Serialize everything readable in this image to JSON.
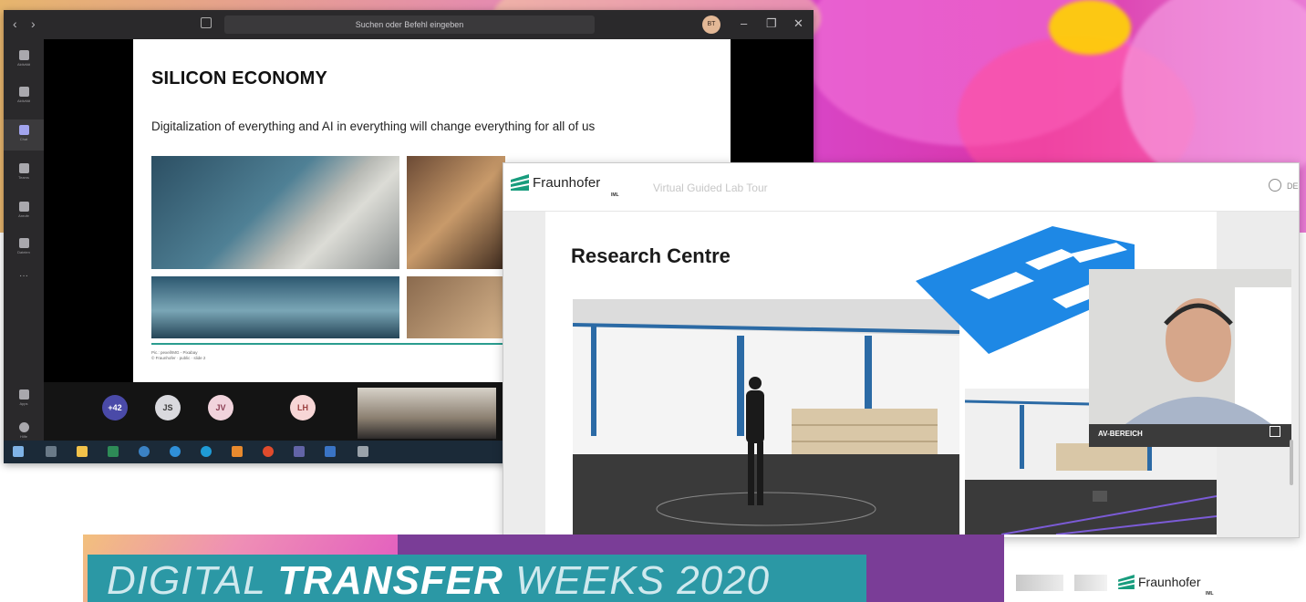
{
  "teams": {
    "search_placeholder": "Suchen oder Befehl eingeben",
    "nav_back": "‹",
    "nav_forward": "›",
    "avatar_initials": "BT",
    "controls": {
      "minimize": "–",
      "restore": "❐",
      "close": "✕"
    },
    "rail": [
      {
        "label": "Aktivität",
        "icon": "activity-icon"
      },
      {
        "label": "Aktivität",
        "icon": "bell-icon"
      },
      {
        "label": "Chat",
        "icon": "chat-icon",
        "active": true
      },
      {
        "label": "Teams",
        "icon": "teams-icon"
      },
      {
        "label": "Anrufe",
        "icon": "phone-icon"
      },
      {
        "label": "Dateien",
        "icon": "file-icon"
      },
      {
        "label": "···",
        "icon": "more-icon"
      },
      {
        "label": "Apps",
        "icon": "apps-icon"
      },
      {
        "label": "Hilfe",
        "icon": "help-icon"
      }
    ],
    "slide": {
      "title": "SILICON ECONOMY",
      "subtitle": "Digitalization of everything and AI in everything will change everything for all of us",
      "footer_line1": "Pic.: pexel/IMG - Pixabay",
      "footer_line2": "© Fraunhofer · public · slide 2"
    },
    "participants": [
      {
        "initials": "+42",
        "bg": "#4a4aa8",
        "fg": "#ffffff"
      },
      {
        "initials": "JS",
        "bg": "#d9d9de",
        "fg": "#3a3a3a"
      },
      {
        "initials": "JV",
        "bg": "#f1d3dc",
        "fg": "#8a3d52"
      },
      {
        "initials": "LH",
        "bg": "#f7d6d6",
        "fg": "#9b4040"
      }
    ]
  },
  "fraunhofer": {
    "logo_text": "Fraunhofer",
    "logo_sub": "IML",
    "tour_title": "Virtual Guided Lab Tour",
    "lang": "DE",
    "page_title": "Research Centre",
    "camera_label": "AV-BEREICH",
    "footer_logo": "Fraunhofer",
    "footer_sub": "IML"
  },
  "banner": {
    "word1": "DIGITAL",
    "word2": "TRANSFER",
    "word3": "WEEKS 2020"
  },
  "colors": {
    "fraunhofer_green": "#179c7d",
    "teams_purple": "#6264a7",
    "banner_teal": "#2b98a5"
  }
}
